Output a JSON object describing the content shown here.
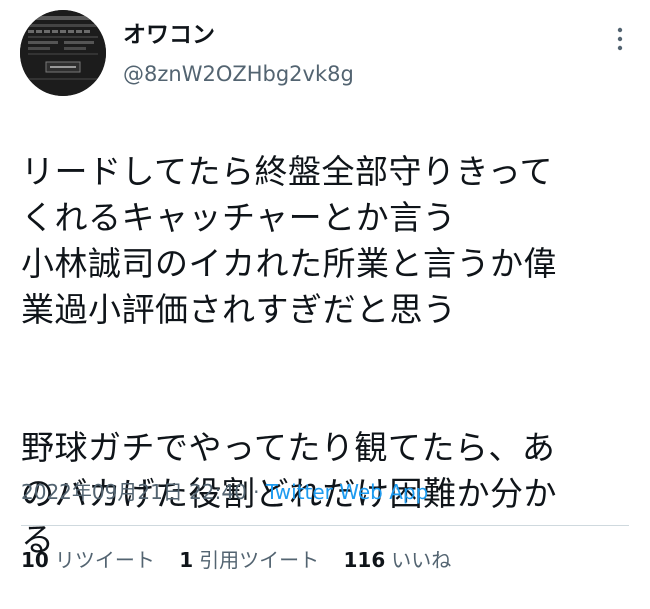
{
  "author": {
    "display_name": "オワコン",
    "handle": "@8znW2OZHbg2vk8g"
  },
  "tweet": {
    "paragraphs": [
      "リードしてたら終盤全部守りきって\nくれるキャッチャーとか言う\n小林誠司のイカれた所業と言うか偉\n業過小評価されすぎだと思う",
      "野球ガチでやってたり観てたら、あ\nのバカげた役割どれだけ困難か分か\nる"
    ]
  },
  "meta": {
    "timestamp": "2022年09月21日 22:40",
    "separator": " · ",
    "source": "Twitter Web App"
  },
  "stats": {
    "retweets": {
      "count": "10",
      "label": "リツイート"
    },
    "quotes": {
      "count": "1",
      "label": "引用ツイート"
    },
    "likes": {
      "count": "116",
      "label": "いいね"
    }
  },
  "colors": {
    "text": "#0f1419",
    "secondary": "#536471",
    "link": "#1d9bf0",
    "divider": "#cfd9de"
  },
  "icons": {
    "more": "more-vertical-icon"
  }
}
